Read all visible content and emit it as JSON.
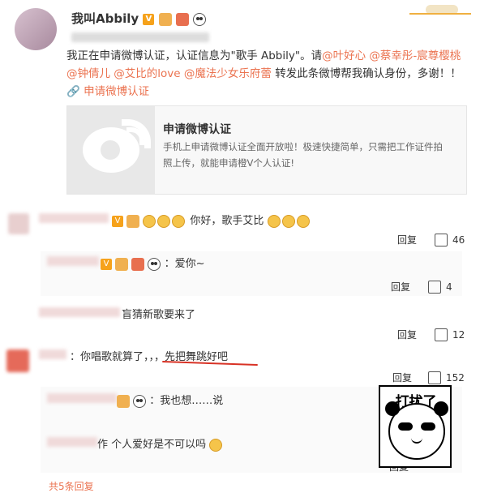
{
  "post": {
    "username": "我叫Abbily",
    "body_line1": "我正在申请微博认证，认证信息为\"歌手 Abbily\"。请",
    "mentions": [
      "@叶好心",
      "@蔡幸彤-宸尊樱桃",
      "@钟倩儿",
      "@艾比的love",
      "@魔法少女乐府蕾"
    ],
    "body_tail": " 转发此条微博帮我确认身份，多谢！！",
    "action_link": "申请微博认证",
    "card_title": "申请微博认证",
    "card_desc": "手机上申请微博认证全面开放啦！极速快捷简单，只需把工作证件拍照上传，就能申请橙V个人认证!"
  },
  "comments": [
    {
      "text": "你好，歌手艾比",
      "reply": "回复",
      "likes": "46"
    },
    {
      "text": "：爱你~",
      "reply": "回复",
      "likes": "4"
    },
    {
      "text": "盲猜新歌要来了",
      "reply": "回复",
      "likes": "12"
    },
    {
      "text": "：你唱歌就算了，，，先把舞跳好吧",
      "reply": "回复",
      "likes": "152"
    },
    {
      "text": "：我也想……说",
      "reply": "回复",
      "likes": "5"
    },
    {
      "text": "作 个人爱好是不可以吗",
      "reply": "回复",
      "likes": ""
    }
  ],
  "footer": {
    "more_replies": "共5条回复"
  },
  "meme_caption": "打扰了"
}
